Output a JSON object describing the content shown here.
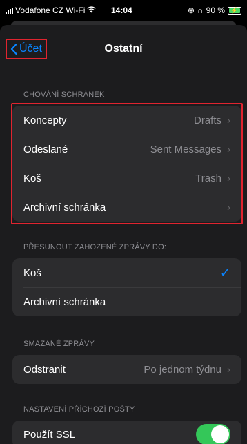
{
  "status": {
    "carrier": "Vodafone CZ Wi-Fi",
    "time": "14:04",
    "battery": "90 %",
    "battery_level": 0.9
  },
  "nav": {
    "back_label": "Účet",
    "title": "Ostatní"
  },
  "sections": {
    "mailbox_behavior": {
      "header": "CHOVÁNÍ SCHRÁNEK",
      "rows": [
        {
          "label": "Koncepty",
          "value": "Drafts"
        },
        {
          "label": "Odeslané",
          "value": "Sent Messages"
        },
        {
          "label": "Koš",
          "value": "Trash"
        },
        {
          "label": "Archivní schránka",
          "value": ""
        }
      ]
    },
    "move_discarded": {
      "header": "PŘESUNOUT ZAHOZENÉ ZPRÁVY DO:",
      "rows": [
        {
          "label": "Koš",
          "selected": true
        },
        {
          "label": "Archivní schránka",
          "selected": false
        }
      ]
    },
    "deleted_messages": {
      "header": "SMAZANÉ ZPRÁVY",
      "row": {
        "label": "Odstranit",
        "value": "Po jednom týdnu"
      }
    },
    "incoming_settings": {
      "header": "NASTAVENÍ PŘÍCHOZÍ POŠTY",
      "row": {
        "label": "Použít SSL",
        "on": true
      }
    }
  },
  "colors": {
    "accent": "#0a84ff",
    "toggle_on": "#34c759",
    "highlight": "#e0242f",
    "background": "#1c1c1e",
    "cell": "#2c2c2e"
  }
}
